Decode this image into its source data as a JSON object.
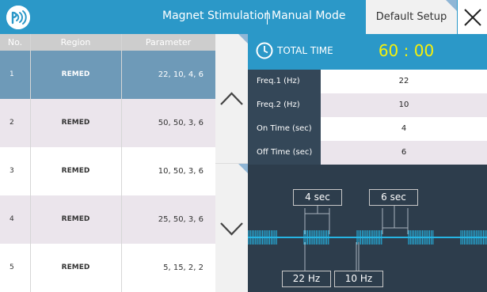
{
  "header": {
    "app_title": "Magnet Stimulation",
    "mode": "Manual Mode",
    "default_button": "Default Setup",
    "close_icon": "close-icon",
    "logo_icon": "coil-logo-icon"
  },
  "table": {
    "headers": [
      "No.",
      "Region",
      "Parameter"
    ],
    "rows": [
      {
        "no": "1",
        "region": "REMED",
        "parameter": "22,  10,  4,  6",
        "selected": true
      },
      {
        "no": "2",
        "region": "REMED",
        "parameter": "50,  50,  3,  6",
        "selected": false
      },
      {
        "no": "3",
        "region": "REMED",
        "parameter": "10,  50,  3,  6",
        "selected": false
      },
      {
        "no": "4",
        "region": "REMED",
        "parameter": "25,  50,  3,  6",
        "selected": false
      },
      {
        "no": "5",
        "region": "REMED",
        "parameter": "5,  15,  2,  2",
        "selected": false
      }
    ]
  },
  "scroll": {
    "up_icon": "chevron-up-icon",
    "down_icon": "chevron-down-icon"
  },
  "total_time": {
    "label": "TOTAL TIME",
    "value": "60 : 00",
    "icon": "clock-icon"
  },
  "params": [
    {
      "label": "Freq.1 (Hz)",
      "value": "22"
    },
    {
      "label": "Freq.2 (Hz)",
      "value": "10"
    },
    {
      "label": "On Time (sec)",
      "value": "4"
    },
    {
      "label": "Off Time (sec)",
      "value": "6"
    }
  ],
  "waveform": {
    "on_time_tag": "4 sec",
    "off_time_tag": "6 sec",
    "freq1_tag": "22 Hz",
    "freq2_tag": "10 Hz"
  },
  "colors": {
    "accent": "#2b98c8",
    "selected_row": "#6e9ab8",
    "alt_row": "#ebe5ec",
    "dark_panel": "#2d3d4c",
    "label_panel": "#344758",
    "total_value": "#f6f10a",
    "wave": "#26b4e3"
  }
}
